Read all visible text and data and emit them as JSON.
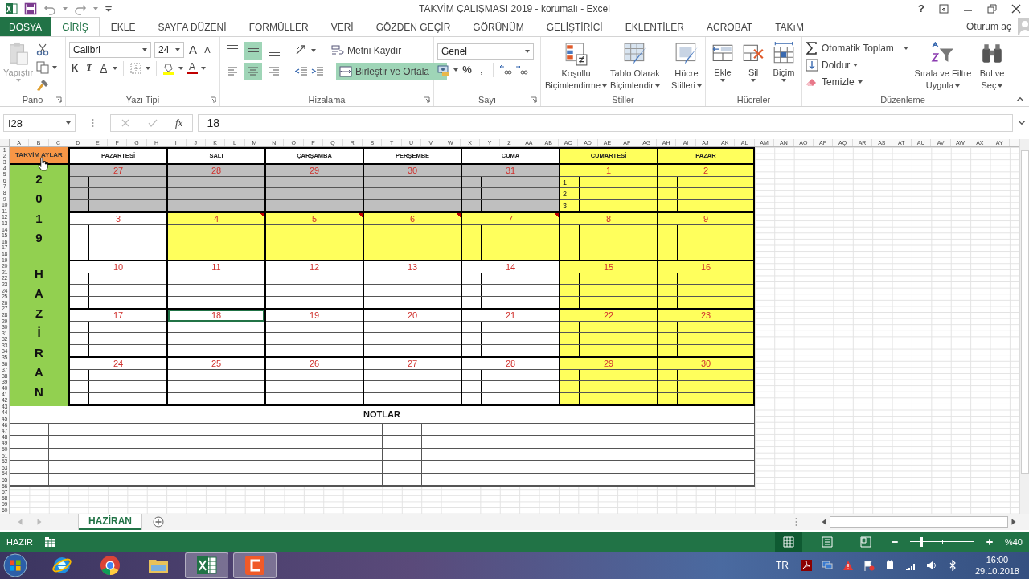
{
  "window": {
    "title": "TAKVİM ÇALIŞMASI 2019 - korumalı - Excel",
    "help": "?"
  },
  "tabs": [
    {
      "label": "DOSYA",
      "kind": "file",
      "selected": false
    },
    {
      "label": "GİRİŞ",
      "kind": "tab",
      "selected": true
    },
    {
      "label": "EKLE",
      "kind": "tab",
      "selected": false
    },
    {
      "label": "SAYFA DÜZENİ",
      "kind": "tab",
      "selected": false
    },
    {
      "label": "FORMÜLLER",
      "kind": "tab",
      "selected": false
    },
    {
      "label": "VERİ",
      "kind": "tab",
      "selected": false
    },
    {
      "label": "GÖZDEN GEÇİR",
      "kind": "tab",
      "selected": false
    },
    {
      "label": "GÖRÜNÜM",
      "kind": "tab",
      "selected": false
    },
    {
      "label": "GELİŞTİRİCİ",
      "kind": "tab",
      "selected": false
    },
    {
      "label": "EKLENTİLER",
      "kind": "tab",
      "selected": false
    },
    {
      "label": "ACROBAT",
      "kind": "tab",
      "selected": false
    },
    {
      "label": "TAKıM",
      "kind": "tab",
      "selected": false
    }
  ],
  "account": "Oturum aç",
  "ribbon": {
    "clipboard": {
      "group": "Pano",
      "paste": "Yapıştır",
      "paste_disabled": true
    },
    "font": {
      "group": "Yazı Tipi",
      "name": "Calibri",
      "size": "24",
      "grow": "A",
      "shrink": "A",
      "bold": "K",
      "italic": "T",
      "underline": "A",
      "font_color_button": "A"
    },
    "alignment": {
      "group": "Hizalama",
      "vertical": [
        {
          "kind": "top",
          "selected": false
        },
        {
          "kind": "middle",
          "selected": true
        },
        {
          "kind": "bottom",
          "selected": false
        }
      ],
      "horizontal": [
        {
          "kind": "left",
          "selected": false
        },
        {
          "kind": "center",
          "selected": true
        },
        {
          "kind": "right",
          "selected": false
        }
      ],
      "wrap": "Metni Kaydır",
      "merge": "Birleştir ve Ortala",
      "merge_on": true
    },
    "number": {
      "group": "Sayı",
      "format": "Genel",
      "percent": "%",
      "comma": ","
    },
    "styles": {
      "group": "Stiller",
      "buttons": [
        {
          "kind": "conditional",
          "lines": [
            "Koşullu",
            "Biçimlendirme"
          ]
        },
        {
          "kind": "table",
          "lines": [
            "Tablo Olarak",
            "Biçimlendir"
          ]
        },
        {
          "kind": "cell",
          "lines": [
            "Hücre",
            "Stilleri"
          ]
        }
      ]
    },
    "cells": {
      "group": "Hücreler",
      "buttons": [
        {
          "kind": "insert",
          "label": "Ekle"
        },
        {
          "kind": "delete",
          "label": "Sil"
        },
        {
          "kind": "format",
          "label": "Biçim"
        }
      ]
    },
    "editing": {
      "group": "Düzenleme",
      "autosum": "Otomatik Toplam",
      "fill": "Doldur",
      "clear": "Temizle",
      "sort": [
        "Sırala ve Filtre",
        "Uygula"
      ],
      "find": [
        "Bul ve",
        "Seç"
      ]
    }
  },
  "formula_bar": {
    "name_box": "I28",
    "fx": "fx",
    "value": "18"
  },
  "columns": [
    "A",
    "B",
    "C",
    "D",
    "E",
    "F",
    "G",
    "H",
    "I",
    "J",
    "K",
    "L",
    "M",
    "N",
    "O",
    "P",
    "Q",
    "R",
    "S",
    "T",
    "U",
    "V",
    "W",
    "X",
    "Y",
    "Z",
    "AA",
    "AB",
    "AC",
    "AD",
    "AE",
    "AF",
    "AG",
    "AH",
    "AI",
    "AJ",
    "AK",
    "AL",
    "AM",
    "AN",
    "AO",
    "AP",
    "AQ",
    "AR",
    "AS",
    "AT",
    "AU",
    "AV",
    "AW",
    "AX",
    "AY"
  ],
  "rows": [
    "1",
    "2",
    "3",
    "4",
    "5",
    "6",
    "7",
    "8",
    "9",
    "10",
    "11",
    "12",
    "13",
    "14",
    "15",
    "16",
    "17",
    "18",
    "19",
    "20",
    "21",
    "22",
    "23",
    "24",
    "25",
    "26",
    "27",
    "28",
    "29",
    "30",
    "31",
    "32",
    "33",
    "34",
    "35",
    "36",
    "37",
    "38",
    "39",
    "40",
    "41",
    "42",
    "43",
    "44",
    "45",
    "46",
    "47",
    "48",
    "49",
    "50",
    "51",
    "52",
    "53",
    "54",
    "55",
    "56",
    "57",
    "58",
    "59",
    "60"
  ],
  "calendar": {
    "corner": "TAKVİM AYLAR",
    "year": "2019",
    "month": "HAZİRAN",
    "day_names": [
      {
        "label": "PAZARTESİ",
        "color": "#ffffff"
      },
      {
        "label": "SALI",
        "color": "#ffffff"
      },
      {
        "label": "ÇARŞAMBA",
        "color": "#ffffff"
      },
      {
        "label": "PERŞEMBE",
        "color": "#ffffff"
      },
      {
        "label": "CUMA",
        "color": "#ffffff"
      },
      {
        "label": "CUMARTESİ",
        "color": "#ffff5c"
      },
      {
        "label": "PAZAR",
        "color": "#ffff5c"
      }
    ],
    "days": [
      {
        "number": "27",
        "color": "#bfbfbf",
        "comment": false,
        "selected": false
      },
      {
        "number": "28",
        "color": "#bfbfbf",
        "comment": false,
        "selected": false
      },
      {
        "number": "29",
        "color": "#bfbfbf",
        "comment": false,
        "selected": false
      },
      {
        "number": "30",
        "color": "#bfbfbf",
        "comment": false,
        "selected": false
      },
      {
        "number": "31",
        "color": "#bfbfbf",
        "comment": false,
        "selected": false
      },
      {
        "number": "1",
        "color": "#ffff5c",
        "comment": false,
        "selected": false,
        "sub_labels": [
          "1",
          "2",
          "3"
        ]
      },
      {
        "number": "2",
        "color": "#ffff5c",
        "comment": false,
        "selected": false
      },
      {
        "number": "3",
        "color": "#ffffff",
        "comment": false,
        "selected": false
      },
      {
        "number": "4",
        "color": "#ffff5c",
        "comment": true,
        "selected": false
      },
      {
        "number": "5",
        "color": "#ffff5c",
        "comment": true,
        "selected": false
      },
      {
        "number": "6",
        "color": "#ffff5c",
        "comment": true,
        "selected": false
      },
      {
        "number": "7",
        "color": "#ffff5c",
        "comment": true,
        "selected": false
      },
      {
        "number": "8",
        "color": "#ffff5c",
        "comment": false,
        "selected": false
      },
      {
        "number": "9",
        "color": "#ffff5c",
        "comment": false,
        "selected": false
      },
      {
        "number": "10",
        "color": "#ffffff",
        "comment": false,
        "selected": false
      },
      {
        "number": "11",
        "color": "#ffffff",
        "comment": false,
        "selected": false
      },
      {
        "number": "12",
        "color": "#ffffff",
        "comment": false,
        "selected": false
      },
      {
        "number": "13",
        "color": "#ffffff",
        "comment": false,
        "selected": false
      },
      {
        "number": "14",
        "color": "#ffffff",
        "comment": false,
        "selected": false
      },
      {
        "number": "15",
        "color": "#ffff5c",
        "comment": false,
        "selected": false
      },
      {
        "number": "16",
        "color": "#ffff5c",
        "comment": false,
        "selected": false
      },
      {
        "number": "17",
        "color": "#ffffff",
        "comment": false,
        "selected": false
      },
      {
        "number": "18",
        "color": "#ffffff",
        "comment": false,
        "selected": true
      },
      {
        "number": "19",
        "color": "#ffffff",
        "comment": false,
        "selected": false
      },
      {
        "number": "20",
        "color": "#ffffff",
        "comment": false,
        "selected": false
      },
      {
        "number": "21",
        "color": "#ffffff",
        "comment": false,
        "selected": false
      },
      {
        "number": "22",
        "color": "#ffff5c",
        "comment": false,
        "selected": false
      },
      {
        "number": "23",
        "color": "#ffff5c",
        "comment": false,
        "selected": false
      },
      {
        "number": "24",
        "color": "#ffffff",
        "comment": false,
        "selected": false
      },
      {
        "number": "25",
        "color": "#ffffff",
        "comment": false,
        "selected": false
      },
      {
        "number": "26",
        "color": "#ffffff",
        "comment": false,
        "selected": false
      },
      {
        "number": "27",
        "color": "#ffffff",
        "comment": false,
        "selected": false
      },
      {
        "number": "28",
        "color": "#ffffff",
        "comment": false,
        "selected": false
      },
      {
        "number": "29",
        "color": "#ffff5c",
        "comment": false,
        "selected": false
      },
      {
        "number": "30",
        "color": "#ffff5c",
        "comment": false,
        "selected": false
      }
    ],
    "notes_title": "NOTLAR"
  },
  "sheet_tabs": [
    {
      "label": "HAZİRAN",
      "selected": true
    }
  ],
  "status_bar": {
    "state": "HAZIR",
    "zoom": "%40",
    "zoom_slider": {
      "level": 0.18
    },
    "views": [
      {
        "kind": "normal",
        "selected": true
      },
      {
        "kind": "page_layout",
        "selected": false
      },
      {
        "kind": "page_break",
        "selected": false
      }
    ]
  },
  "taskbar": {
    "apps": [
      {
        "kind": "ie",
        "active": false
      },
      {
        "kind": "chrome",
        "active": false
      },
      {
        "kind": "folder",
        "active": false
      },
      {
        "kind": "excel",
        "active": true
      },
      {
        "kind": "camtasia",
        "active": true
      }
    ],
    "language": "TR",
    "time": "16:00",
    "date": "29.10.2018"
  }
}
